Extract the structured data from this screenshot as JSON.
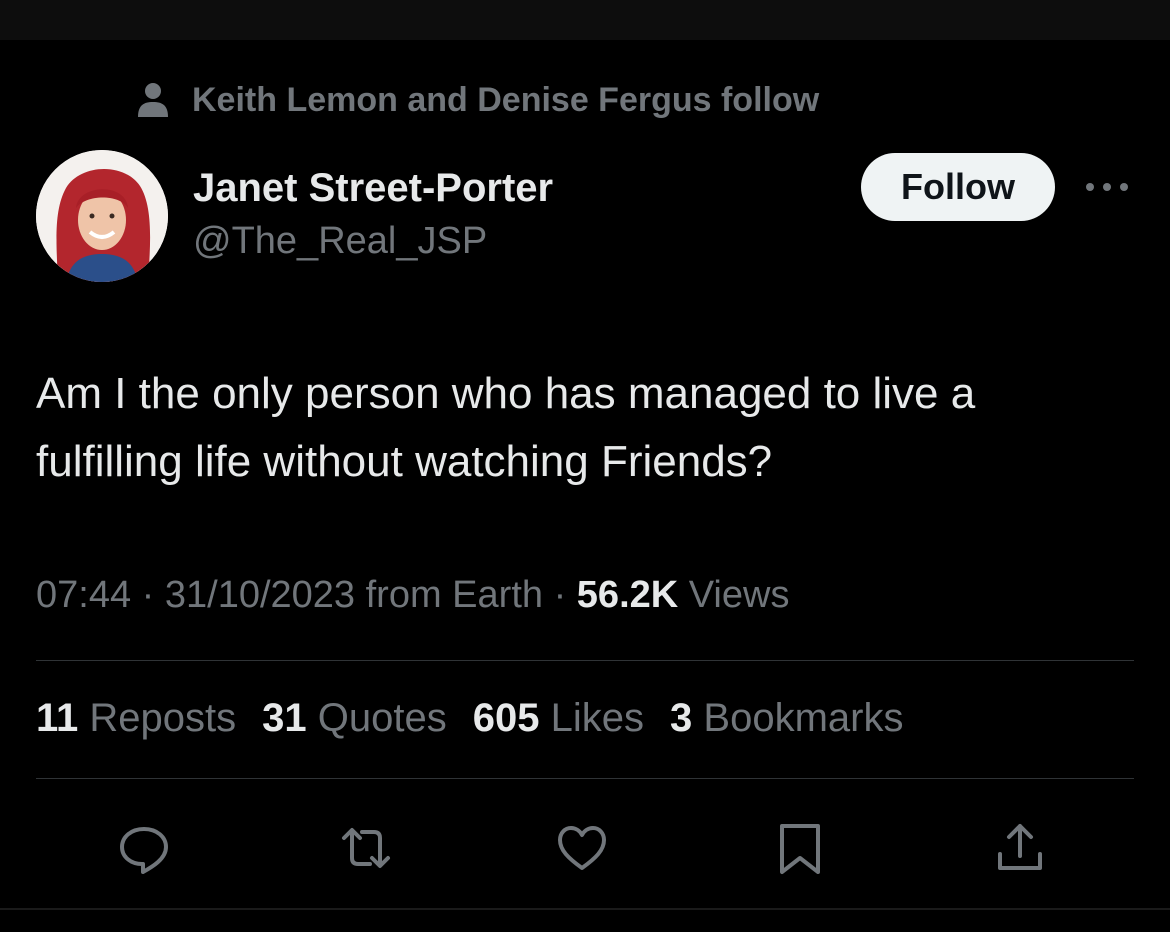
{
  "social_context": {
    "text": "Keith Lemon and Denise Fergus follow",
    "icon": "person-icon"
  },
  "author": {
    "display_name": "Janet Street-Porter",
    "handle": "@The_Real_JSP",
    "avatar": "avatar-photo"
  },
  "follow_label": "Follow",
  "more_icon": "more-dots-icon",
  "tweet": {
    "text_line1": "Am I the only person who has managed to live a",
    "text_line2": "fulfilling life without watching Friends?"
  },
  "meta": {
    "time": "07:44",
    "date": "31/10/2023",
    "from": "from Earth",
    "views_count": "56.2K",
    "views_label": "Views"
  },
  "stats": {
    "reposts_count": "11",
    "reposts_label": "Reposts",
    "quotes_count": "31",
    "quotes_label": "Quotes",
    "likes_count": "605",
    "likes_label": "Likes",
    "bookmarks_count": "3",
    "bookmarks_label": "Bookmarks"
  },
  "actions": [
    "reply-icon",
    "repost-icon",
    "like-icon",
    "bookmark-icon",
    "share-icon"
  ],
  "colors": {
    "background": "#000000",
    "text": "#e7e9ea",
    "secondary": "#71767b",
    "divider": "#2f3336",
    "button_bg": "#eff3f4"
  }
}
